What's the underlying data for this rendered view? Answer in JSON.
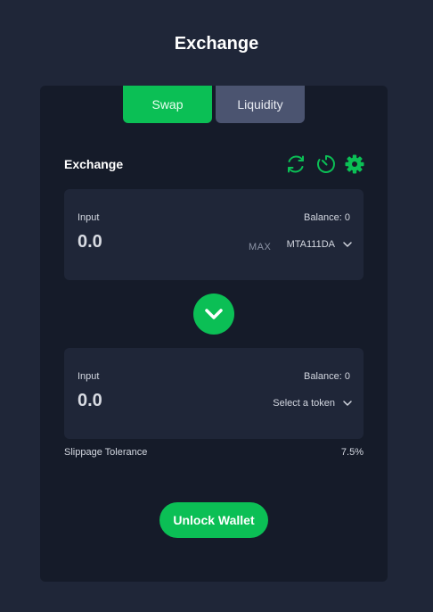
{
  "page": {
    "title": "Exchange"
  },
  "tabs": [
    {
      "label": "Swap",
      "active": true
    },
    {
      "label": "Liquidity",
      "active": false
    }
  ],
  "exchange": {
    "section_title": "Exchange",
    "icons": [
      "refresh-icon",
      "timer-icon",
      "settings-gear-icon"
    ]
  },
  "input_panel": {
    "label": "Input",
    "balance": "Balance: 0",
    "amount": "0.0",
    "max_label": "MAX",
    "token": "MTA111DA"
  },
  "output_panel": {
    "label": "Input",
    "balance": "Balance: 0",
    "amount": "0.0",
    "token": "Select a token"
  },
  "slippage": {
    "label": "Slippage Tolerance",
    "value": "7.5%"
  },
  "actions": {
    "unlock_label": "Unlock Wallet"
  },
  "colors": {
    "background": "#1f2638",
    "card": "#151b29",
    "panel": "#1f2638",
    "accent": "#0bbf55",
    "inactive_tab": "#4b5470"
  }
}
